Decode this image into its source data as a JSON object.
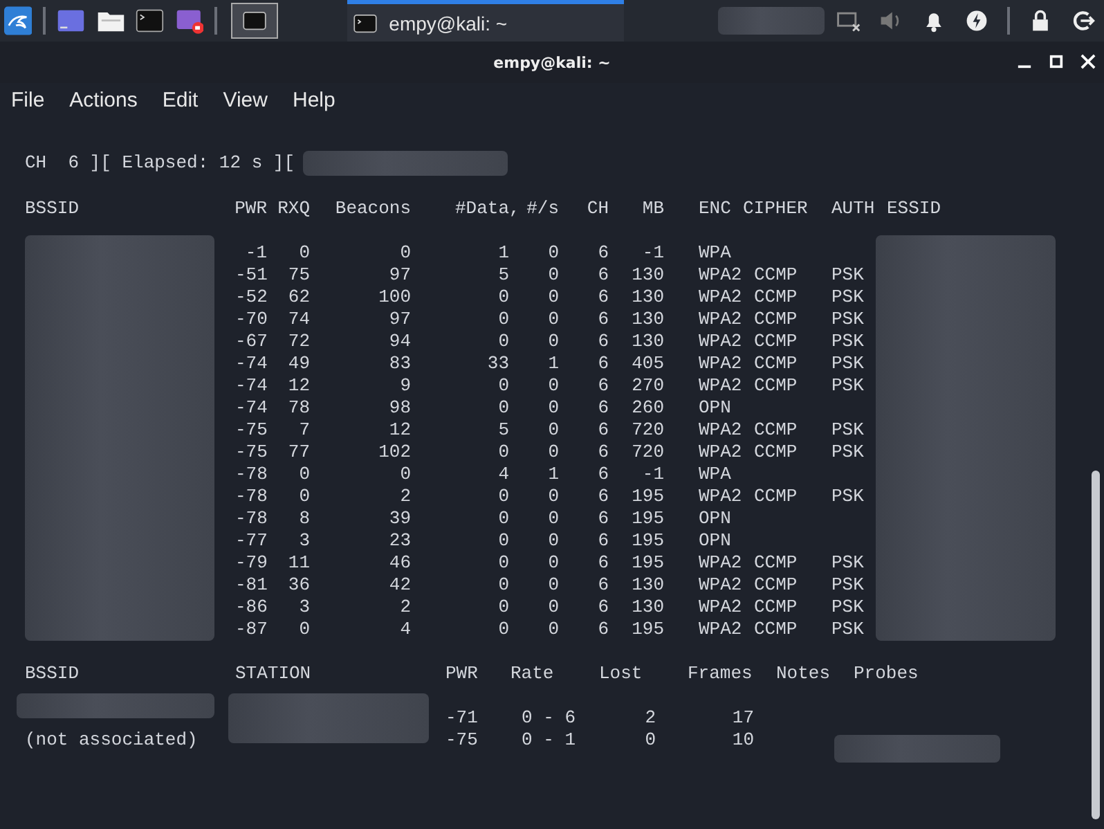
{
  "taskbar": {
    "tasks": [
      {
        "label": "empy@kali: ~",
        "selected": true
      }
    ]
  },
  "window": {
    "title": "empy@kali: ~"
  },
  "menu": [
    "File",
    "Actions",
    "Edit",
    "View",
    "Help"
  ],
  "status_line": "CH  6 ][ Elapsed: 12 s ][",
  "ap_table": {
    "columns": [
      "BSSID",
      "PWR",
      "RXQ",
      "Beacons",
      "#Data,",
      "#/s",
      "CH",
      "MB",
      "ENC",
      "CIPHER",
      "AUTH",
      "ESSID"
    ],
    "rows": [
      {
        "pwr": "-1",
        "rxq": "0",
        "beacons": "0",
        "data": "1",
        "rate": "0",
        "ch": "6",
        "mb": "-1",
        "enc": "WPA"
      },
      {
        "pwr": "-51",
        "rxq": "75",
        "beacons": "97",
        "data": "5",
        "rate": "0",
        "ch": "6",
        "mb": "130",
        "enc": "WPA2",
        "cipher": "CCMP",
        "auth": "PSK"
      },
      {
        "pwr": "-52",
        "rxq": "62",
        "beacons": "100",
        "data": "0",
        "rate": "0",
        "ch": "6",
        "mb": "130",
        "enc": "WPA2",
        "cipher": "CCMP",
        "auth": "PSK"
      },
      {
        "pwr": "-70",
        "rxq": "74",
        "beacons": "97",
        "data": "0",
        "rate": "0",
        "ch": "6",
        "mb": "130",
        "enc": "WPA2",
        "cipher": "CCMP",
        "auth": "PSK"
      },
      {
        "pwr": "-67",
        "rxq": "72",
        "beacons": "94",
        "data": "0",
        "rate": "0",
        "ch": "6",
        "mb": "130",
        "enc": "WPA2",
        "cipher": "CCMP",
        "auth": "PSK"
      },
      {
        "pwr": "-74",
        "rxq": "49",
        "beacons": "83",
        "data": "33",
        "rate": "1",
        "ch": "6",
        "mb": "405",
        "enc": "WPA2",
        "cipher": "CCMP",
        "auth": "PSK"
      },
      {
        "pwr": "-74",
        "rxq": "12",
        "beacons": "9",
        "data": "0",
        "rate": "0",
        "ch": "6",
        "mb": "270",
        "enc": "WPA2",
        "cipher": "CCMP",
        "auth": "PSK"
      },
      {
        "pwr": "-74",
        "rxq": "78",
        "beacons": "98",
        "data": "0",
        "rate": "0",
        "ch": "6",
        "mb": "260",
        "enc": "OPN"
      },
      {
        "pwr": "-75",
        "rxq": "7",
        "beacons": "12",
        "data": "5",
        "rate": "0",
        "ch": "6",
        "mb": "720",
        "enc": "WPA2",
        "cipher": "CCMP",
        "auth": "PSK"
      },
      {
        "pwr": "-75",
        "rxq": "77",
        "beacons": "102",
        "data": "0",
        "rate": "0",
        "ch": "6",
        "mb": "720",
        "enc": "WPA2",
        "cipher": "CCMP",
        "auth": "PSK"
      },
      {
        "pwr": "-78",
        "rxq": "0",
        "beacons": "0",
        "data": "4",
        "rate": "1",
        "ch": "6",
        "mb": "-1",
        "enc": "WPA"
      },
      {
        "pwr": "-78",
        "rxq": "0",
        "beacons": "2",
        "data": "0",
        "rate": "0",
        "ch": "6",
        "mb": "195",
        "enc": "WPA2",
        "cipher": "CCMP",
        "auth": "PSK"
      },
      {
        "pwr": "-78",
        "rxq": "8",
        "beacons": "39",
        "data": "0",
        "rate": "0",
        "ch": "6",
        "mb": "195",
        "enc": "OPN"
      },
      {
        "pwr": "-77",
        "rxq": "3",
        "beacons": "23",
        "data": "0",
        "rate": "0",
        "ch": "6",
        "mb": "195",
        "enc": "OPN"
      },
      {
        "pwr": "-79",
        "rxq": "11",
        "beacons": "46",
        "data": "0",
        "rate": "0",
        "ch": "6",
        "mb": "195",
        "enc": "WPA2",
        "cipher": "CCMP",
        "auth": "PSK"
      },
      {
        "pwr": "-81",
        "rxq": "36",
        "beacons": "42",
        "data": "0",
        "rate": "0",
        "ch": "6",
        "mb": "130",
        "enc": "WPA2",
        "cipher": "CCMP",
        "auth": "PSK"
      },
      {
        "pwr": "-86",
        "rxq": "3",
        "beacons": "2",
        "data": "0",
        "rate": "0",
        "ch": "6",
        "mb": "130",
        "enc": "WPA2",
        "cipher": "CCMP",
        "auth": "PSK"
      },
      {
        "pwr": "-87",
        "rxq": "0",
        "beacons": "4",
        "data": "0",
        "rate": "0",
        "ch": "6",
        "mb": "195",
        "enc": "WPA2",
        "cipher": "CCMP",
        "auth": "PSK"
      }
    ]
  },
  "station_table": {
    "columns": [
      "BSSID",
      "STATION",
      "PWR",
      "Rate",
      "Lost",
      "Frames",
      "Notes",
      "Probes"
    ],
    "rows": [
      {
        "bssid_redacted": true,
        "pwr": "-71",
        "rate": "0 - 6",
        "lost": "2",
        "frames": "17",
        "probes_redacted": false
      },
      {
        "bssid": "(not associated)",
        "bssid_redacted": false,
        "pwr": "-75",
        "rate": "0 - 1",
        "lost": "0",
        "frames": "10",
        "probes_redacted": true
      }
    ]
  }
}
